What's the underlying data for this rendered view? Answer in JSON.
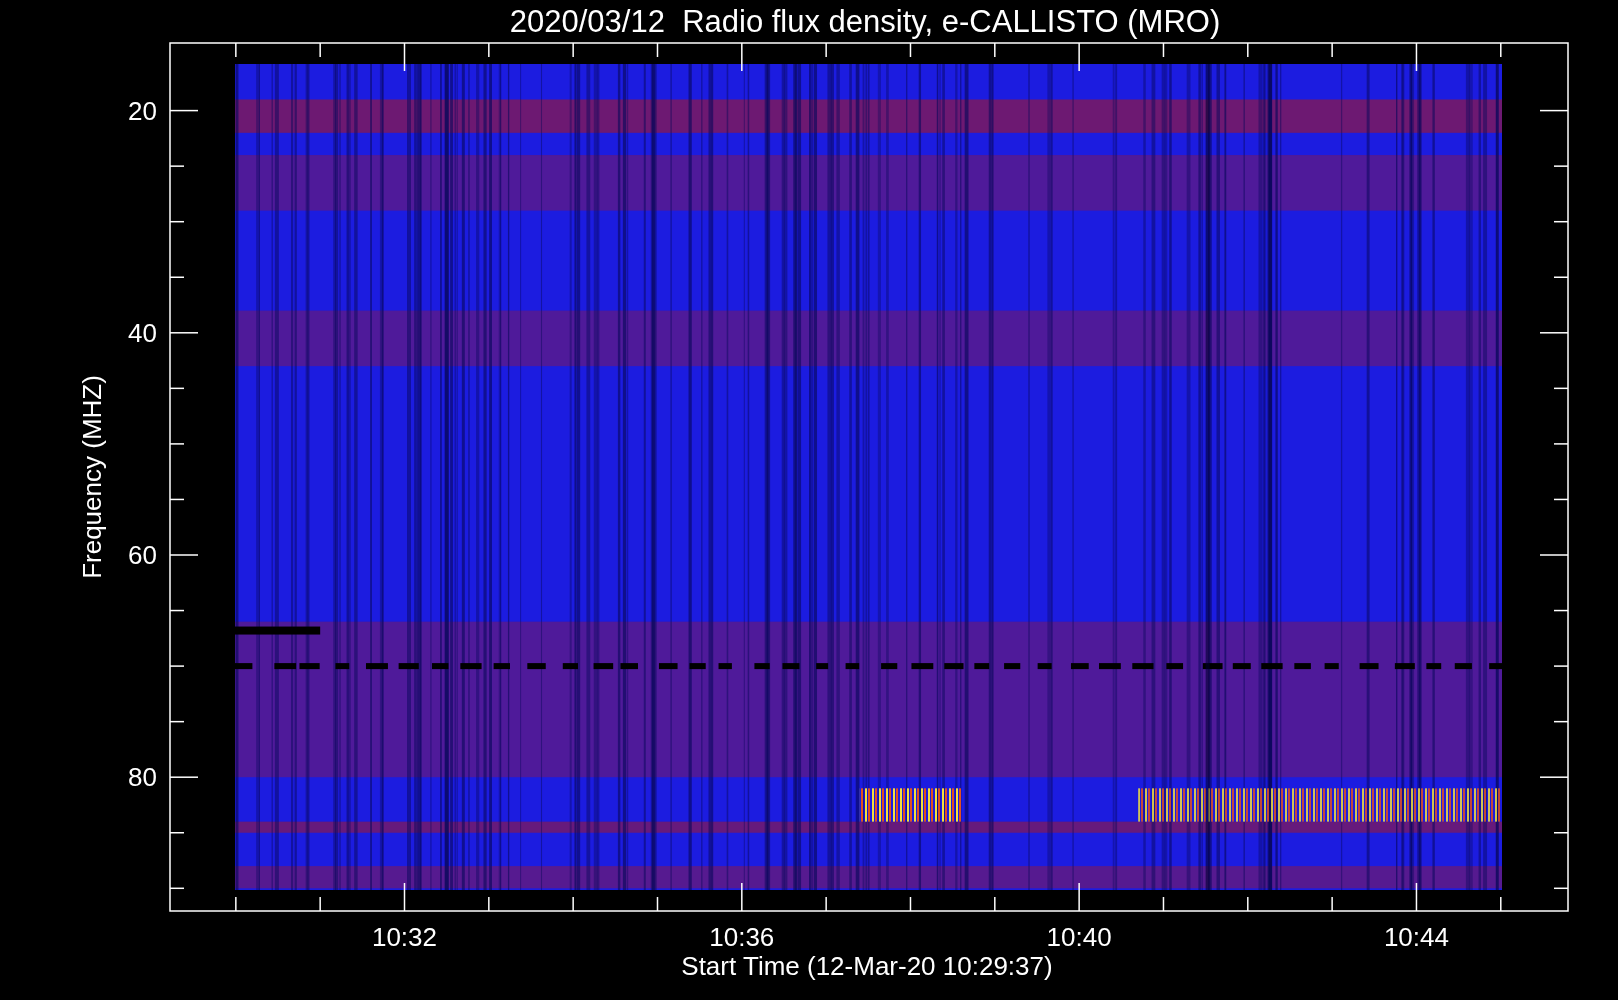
{
  "plot": {
    "title": "2020/03/12  Radio flux density, e-CALLISTO (MRO)",
    "xlabel": "Start Time (12-Mar-20 10:29:37)",
    "ylabel": "Frequency (MHZ)",
    "yticks": [
      "20",
      "40",
      "60",
      "80"
    ],
    "xticks": [
      "10:32",
      "10:36",
      "10:40",
      "10:44"
    ]
  }
}
